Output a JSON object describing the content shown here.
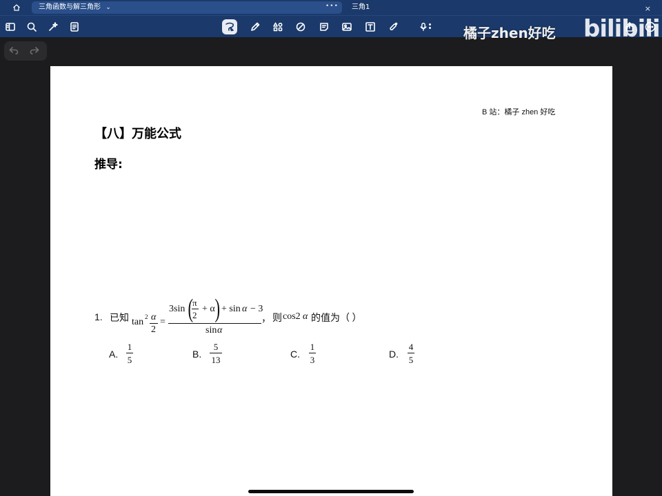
{
  "tabs": {
    "active_title": "三角函数与解三角形",
    "active_chevron": "⌄",
    "more": "•••",
    "inactive_title": "三角1",
    "close": "×"
  },
  "toolbar": {
    "left_icons": [
      "sidebar-icon",
      "search-icon",
      "bookmark-star-icon",
      "document-icon"
    ],
    "center_icons": [
      "lasso-icon",
      "pen-icon",
      "shapes-icon",
      "eraser-icon",
      "sticky-note-icon",
      "image-icon",
      "text-box-icon",
      "laser-pointer-icon",
      "microphone-icon"
    ],
    "right_icons": [
      "share-icon",
      "more-icon"
    ],
    "selected_icon": "lasso-icon"
  },
  "watermark": {
    "uploader": "橘子zhen好吃",
    "logo": "bilibili"
  },
  "page": {
    "header_right": "B 站：橘子 zhen 好吃",
    "section_title": "【八】万能公式",
    "derive_label": "推导:",
    "question": {
      "number": "1.",
      "given": "已知",
      "tan": "tan",
      "sup": "2",
      "alpha": "α",
      "two": "2",
      "eq": "=",
      "num_pre": "3sin",
      "pi": "π",
      "plus_alpha": "+ α",
      "num_post": "+ sin",
      "minus3": "− 3",
      "den": "sin",
      "comma": "，",
      "ask_pre": "则",
      "ask_expr": "cos2",
      "ask_post": "的值为（    ）"
    },
    "choices": [
      {
        "label": "A.",
        "num": "1",
        "den": "5"
      },
      {
        "label": "B.",
        "num": "5",
        "den": "13"
      },
      {
        "label": "C.",
        "num": "1",
        "den": "3"
      },
      {
        "label": "D.",
        "num": "4",
        "den": "5"
      }
    ]
  }
}
